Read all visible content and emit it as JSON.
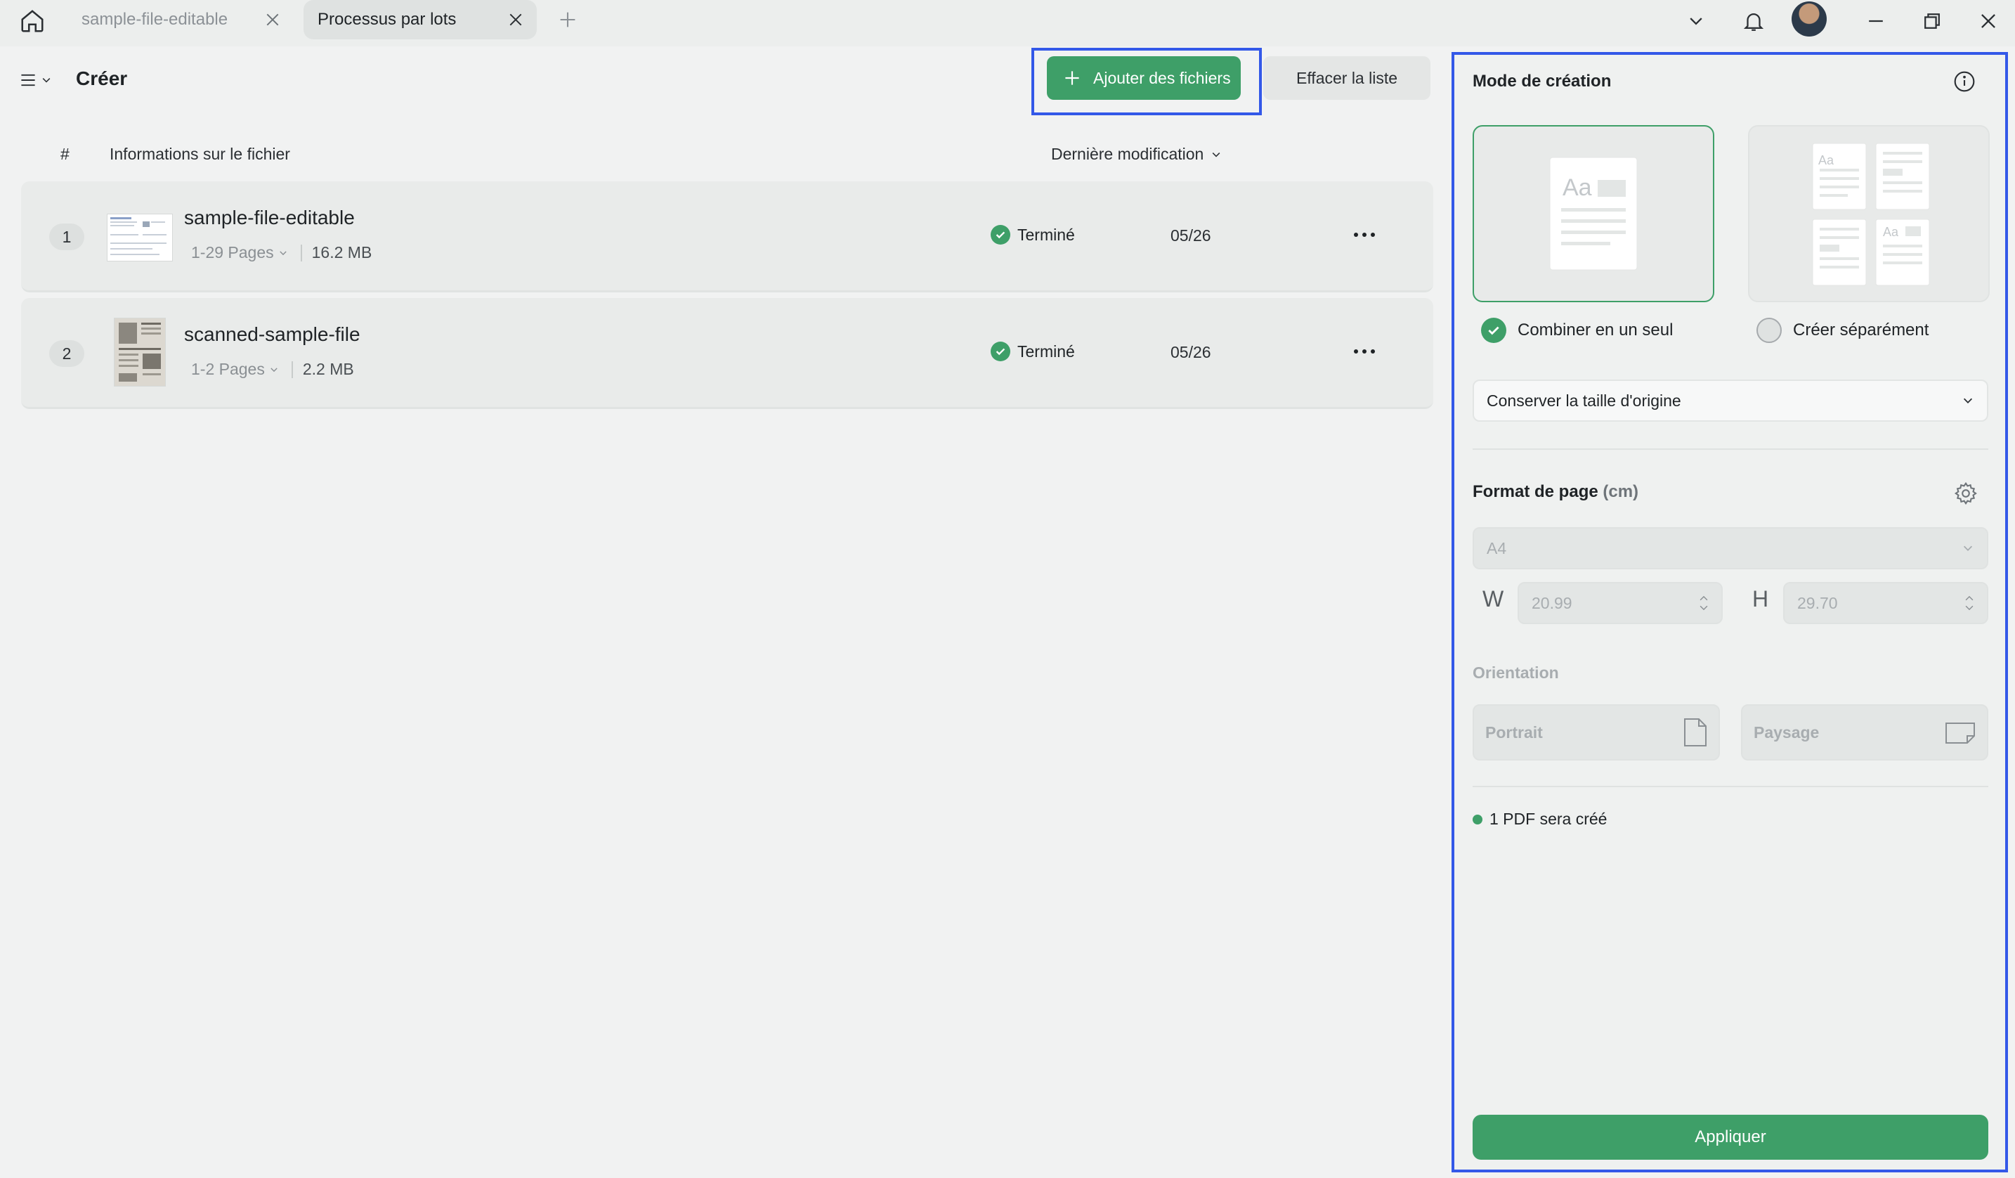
{
  "window": {
    "tabs": [
      {
        "label": "sample-file-editable",
        "active": false
      },
      {
        "label": "Processus par lots",
        "active": true
      }
    ],
    "icons": {
      "home": "home-icon",
      "new_tab": "plus-icon",
      "dropdown": "chevron-down-icon",
      "notifications": "bell-icon",
      "minimize": "minimize-icon",
      "restore": "restore-icon",
      "close": "close-icon"
    }
  },
  "toolbar": {
    "title": "Créer",
    "add_files_label": "Ajouter des fichiers",
    "clear_list_label": "Effacer la liste"
  },
  "table": {
    "headers": {
      "index": "#",
      "file_info": "Informations sur le fichier",
      "last_modified": "Dernière modification"
    },
    "rows": [
      {
        "index": "1",
        "name": "sample-file-editable",
        "pages": "1-29 Pages",
        "size": "16.2 MB",
        "status": "Terminé",
        "date": "05/26"
      },
      {
        "index": "2",
        "name": "scanned-sample-file",
        "pages": "1-2 Pages",
        "size": "2.2 MB",
        "status": "Terminé",
        "date": "05/26"
      }
    ]
  },
  "panel": {
    "title": "Mode de création",
    "mode_combine": "Combiner en un seul",
    "mode_separate": "Créer séparément",
    "size_option": "Conserver la taille d'origine",
    "format_title": "Format de page",
    "format_unit": "(cm)",
    "page_size": "A4",
    "width_label": "W",
    "width_value": "20.99",
    "height_label": "H",
    "height_value": "29.70",
    "orientation_title": "Orientation",
    "portrait_label": "Portrait",
    "landscape_label": "Paysage",
    "pdf_note": "1 PDF sera créé",
    "apply_label": "Appliquer"
  },
  "colors": {
    "accent": "#3e9f68",
    "highlight": "#3358e8"
  }
}
